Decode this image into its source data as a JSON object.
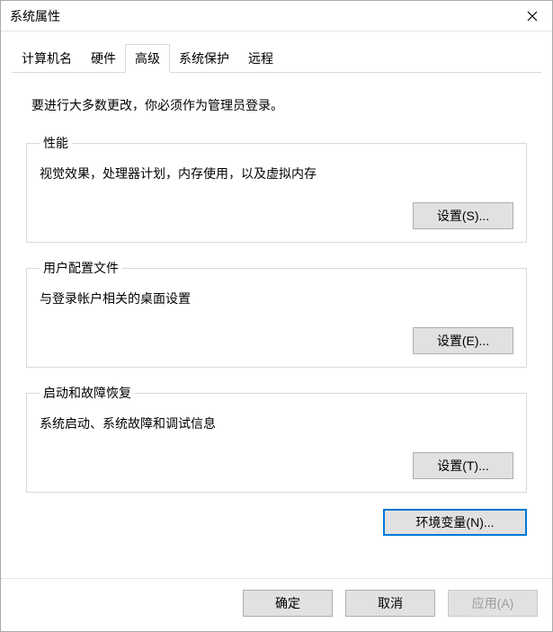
{
  "window": {
    "title": "系统属性"
  },
  "tabs": {
    "computer_name": "计算机名",
    "hardware": "硬件",
    "advanced": "高级",
    "system_protection": "系统保护",
    "remote": "远程"
  },
  "admin_note": "要进行大多数更改，你必须作为管理员登录。",
  "sections": {
    "performance": {
      "legend": "性能",
      "desc": "视觉效果，处理器计划，内存使用，以及虚拟内存",
      "button": "设置(S)..."
    },
    "profiles": {
      "legend": "用户配置文件",
      "desc": "与登录帐户相关的桌面设置",
      "button": "设置(E)..."
    },
    "startup": {
      "legend": "启动和故障恢复",
      "desc": "系统启动、系统故障和调试信息",
      "button": "设置(T)..."
    }
  },
  "env_button": "环境变量(N)...",
  "footer": {
    "ok": "确定",
    "cancel": "取消",
    "apply": "应用(A)"
  }
}
